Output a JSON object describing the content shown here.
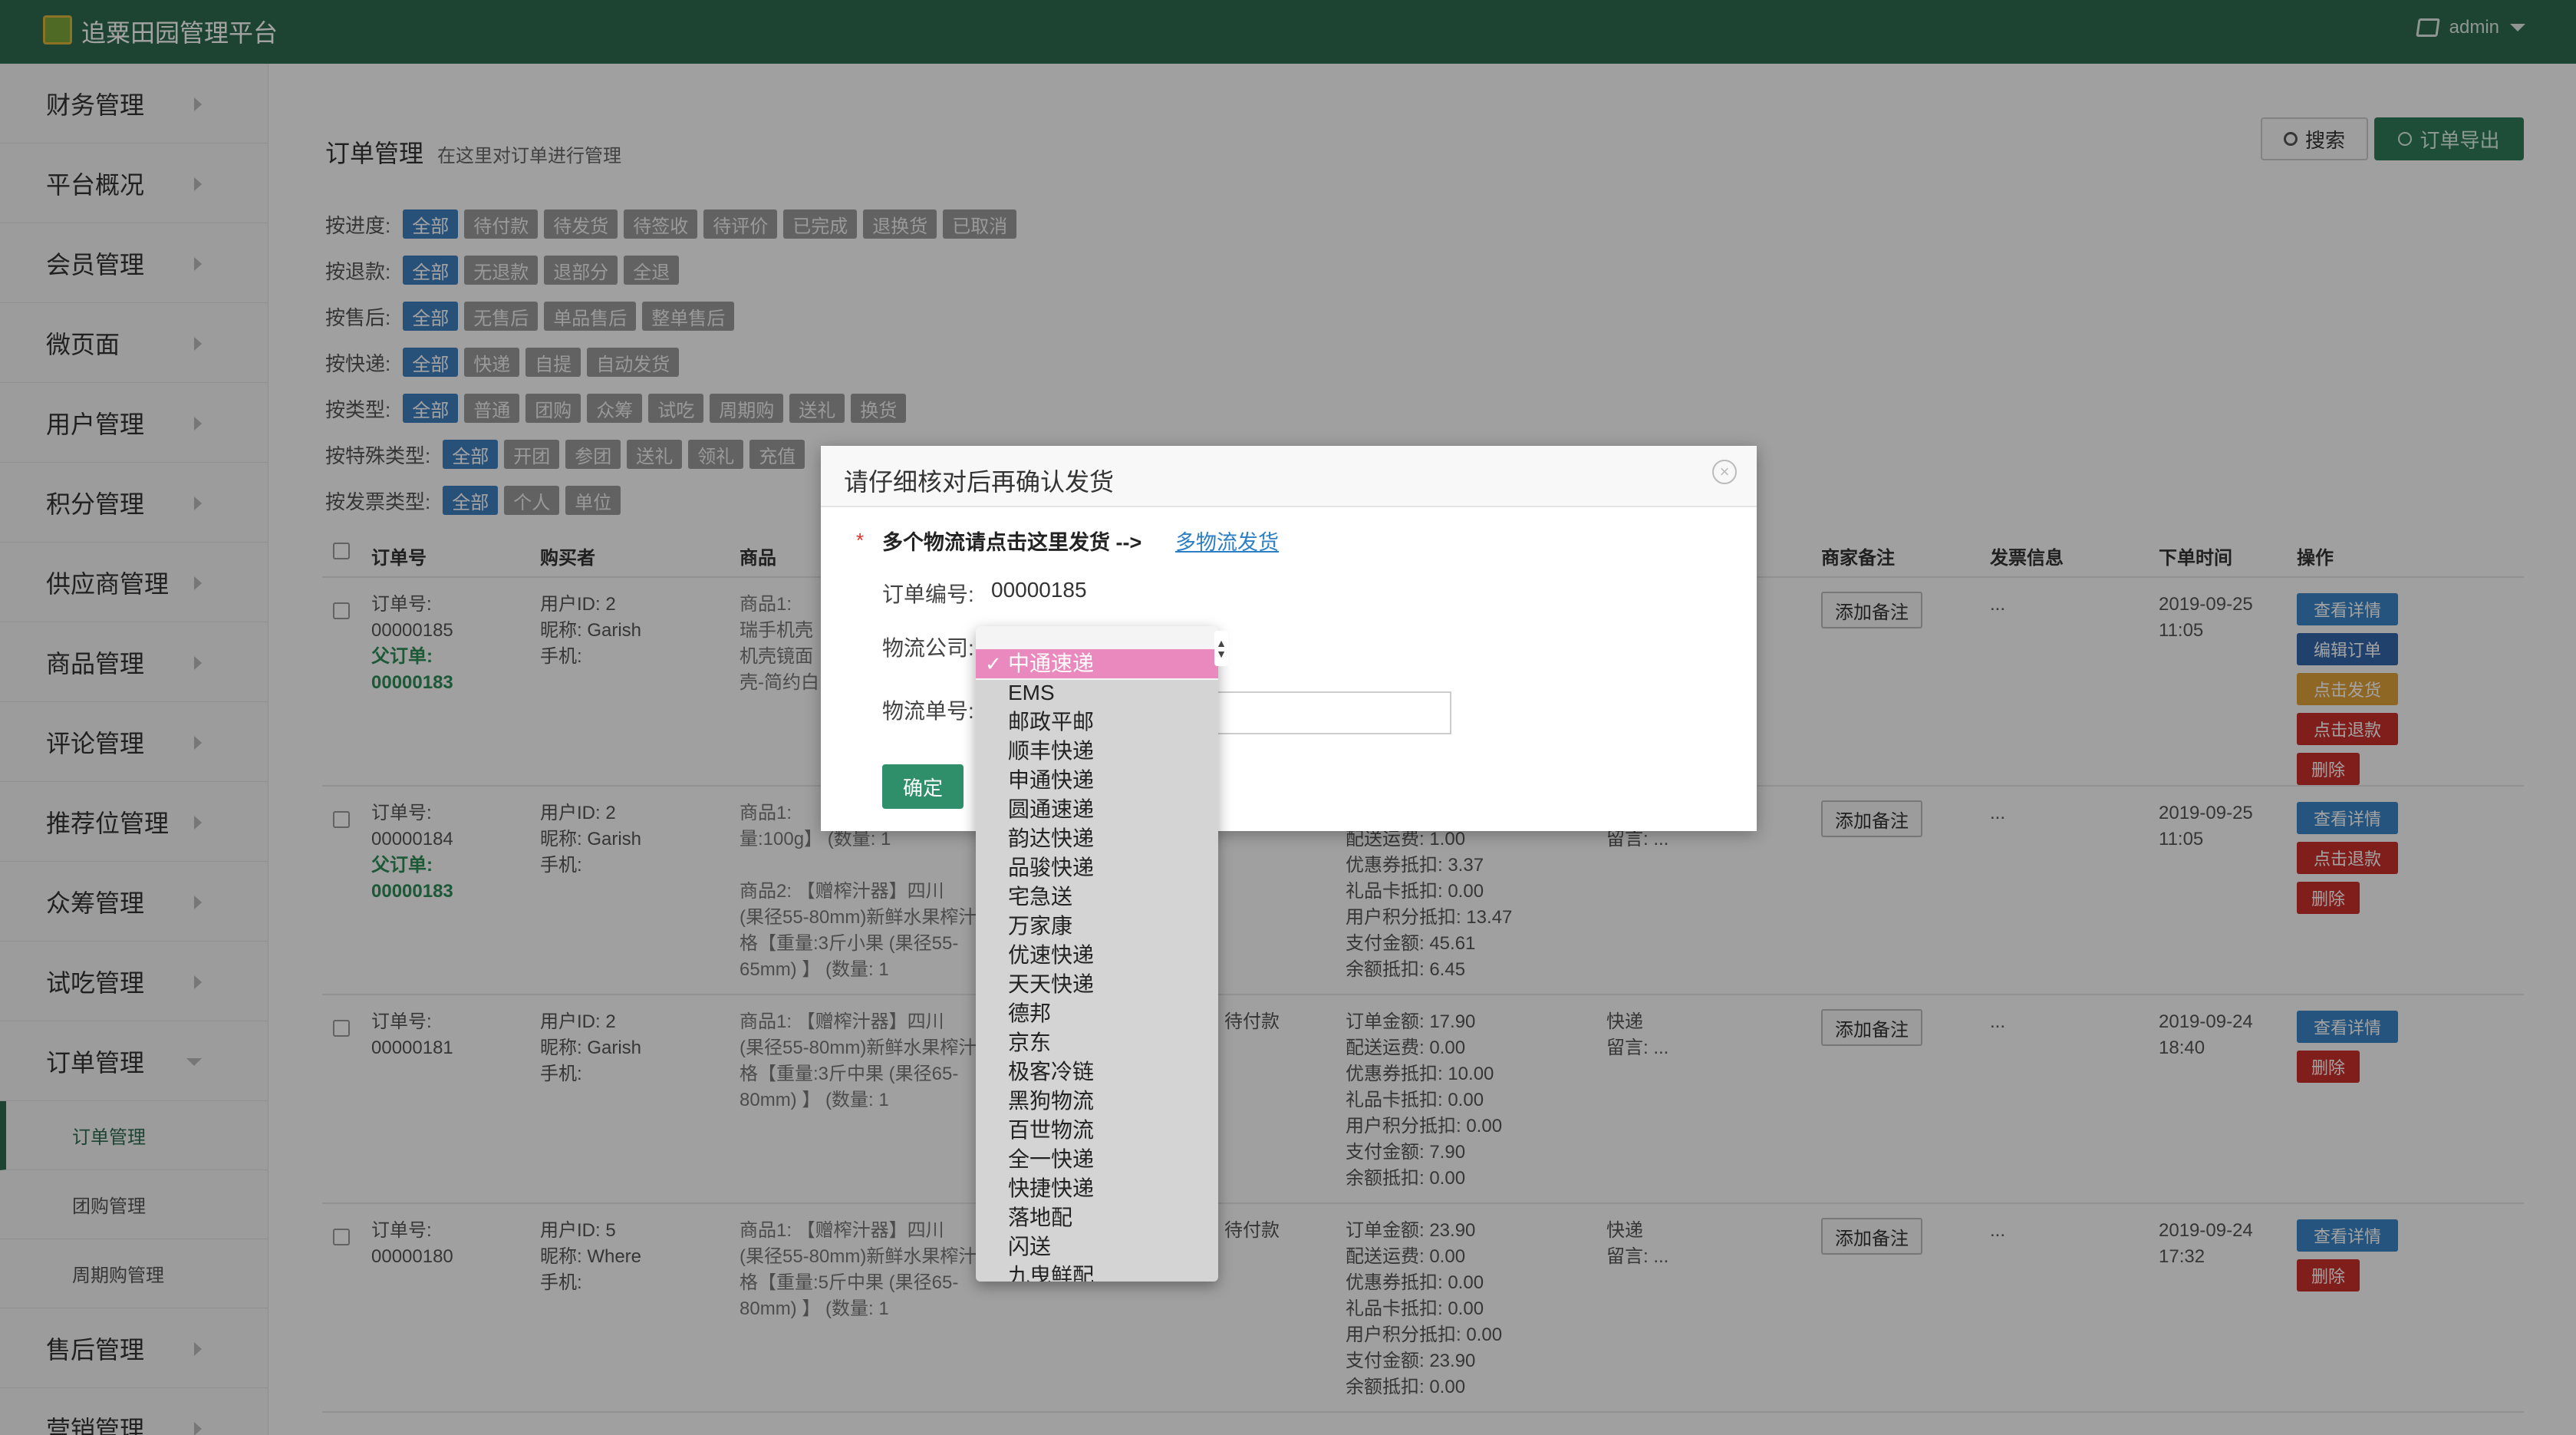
{
  "app": {
    "title": "追粟田园管理平台",
    "user": "admin"
  },
  "sidebar": {
    "items": [
      {
        "label": "财务管理"
      },
      {
        "label": "平台概况"
      },
      {
        "label": "会员管理"
      },
      {
        "label": "微页面"
      },
      {
        "label": "用户管理"
      },
      {
        "label": "积分管理"
      },
      {
        "label": "供应商管理"
      },
      {
        "label": "商品管理"
      },
      {
        "label": "评论管理"
      },
      {
        "label": "推荐位管理"
      },
      {
        "label": "众筹管理"
      },
      {
        "label": "试吃管理"
      },
      {
        "label": "订单管理"
      }
    ],
    "subitems": [
      {
        "label": "订单管理"
      },
      {
        "label": "团购管理"
      },
      {
        "label": "周期购管理"
      }
    ],
    "tail": [
      {
        "label": "售后管理"
      },
      {
        "label": "营销管理"
      }
    ]
  },
  "page": {
    "title": "订单管理",
    "subtitle": "在这里对订单进行管理"
  },
  "toolbar": {
    "search": "搜索",
    "export": "订单导出"
  },
  "filters": [
    {
      "label": "按进度:",
      "chips": [
        "全部",
        "待付款",
        "待发货",
        "待签收",
        "待评价",
        "已完成",
        "退换货",
        "已取消"
      ]
    },
    {
      "label": "按退款:",
      "chips": [
        "全部",
        "无退款",
        "退部分",
        "全退"
      ]
    },
    {
      "label": "按售后:",
      "chips": [
        "全部",
        "无售后",
        "单品售后",
        "整单售后"
      ]
    },
    {
      "label": "按快递:",
      "chips": [
        "全部",
        "快递",
        "自提",
        "自动发货"
      ]
    },
    {
      "label": "按类型:",
      "chips": [
        "全部",
        "普通",
        "团购",
        "众筹",
        "试吃",
        "周期购",
        "送礼",
        "换货"
      ]
    },
    {
      "label": "按特殊类型:",
      "chips": [
        "全部",
        "开团",
        "参团",
        "送礼",
        "领礼",
        "充值"
      ]
    },
    {
      "label": "按发票类型:",
      "chips": [
        "全部",
        "个人",
        "单位"
      ]
    }
  ],
  "table": {
    "headers": [
      "订单号",
      "购买者",
      "商品",
      "商家备注",
      "发票信息",
      "下单时间",
      "操作"
    ],
    "rows": [
      {
        "order_label": "订单号:",
        "order_no": "00000185",
        "parent_label": "父订单:",
        "parent_no": "00000183",
        "buyer": [
          "用户ID:  2",
          "昵称:  Garish",
          "手机:"
        ],
        "goods": [
          "商品1:",
          "瑞手机壳",
          "机壳镜面",
          "壳-简约白"
        ],
        "status": "",
        "amounts": [],
        "ship": [],
        "note_btn": "添加备注",
        "invoice": "...",
        "time": [
          "2019-09-25",
          "11:05"
        ],
        "actions": [
          {
            "label": "查看详情",
            "color": "blue"
          },
          {
            "label": "编辑订单",
            "color": "navy"
          },
          {
            "label": "点击发货",
            "color": "orange"
          },
          {
            "label": "点击退款",
            "color": "red"
          },
          {
            "label": "删除",
            "color": "red"
          }
        ]
      },
      {
        "order_label": "订单号:",
        "order_no": "00000184",
        "parent_label": "父订单:",
        "parent_no": "00000183",
        "buyer": [
          "用户ID:  2",
          "昵称:  Garish",
          "手机:"
        ],
        "goods": [
          "商品1:",
          "量:100g】  (数量:  1",
          "",
          "商品2:  【赠榨汁器】四川",
          "(果径55-80mm)新鲜水果榨汁",
          "格【重量:3斤小果 (果径55-",
          "65mm) 】  (数量:  1"
        ],
        "status": "",
        "amounts": [
          "配送运费:  1.00",
          "优惠券抵扣:  3.37",
          "礼品卡抵扣:  0.00",
          "用户积分抵扣:  13.47",
          "支付金额:  45.61",
          "余额抵扣:  6.45"
        ],
        "ship": [
          "快递",
          "留言:  ..."
        ],
        "note_btn": "添加备注",
        "invoice": "...",
        "time": [
          "2019-09-25",
          "11:05"
        ],
        "actions": [
          {
            "label": "查看详情",
            "color": "blue"
          },
          {
            "label": "点击退款",
            "color": "red"
          },
          {
            "label": "删除",
            "color": "red"
          }
        ]
      },
      {
        "order_label": "订单号:",
        "order_no": "00000181",
        "parent_label": "",
        "parent_no": "",
        "buyer": [
          "用户ID:  2",
          "昵称:  Garish",
          "手机:"
        ],
        "goods": [
          "商品1:   【赠榨汁器】四川",
          "(果径55-80mm)新鲜水果榨汁",
          "格【重量:3斤中果 (果径65-",
          "80mm) 】  (数量:  1"
        ],
        "status": "待付款",
        "amounts": [
          "订单金额:  17.90",
          "配送运费:  0.00",
          "优惠券抵扣:  10.00",
          "礼品卡抵扣:  0.00",
          "用户积分抵扣:  0.00",
          "支付金额:  7.90",
          "余额抵扣:  0.00"
        ],
        "ship": [
          "快递",
          "留言:  ..."
        ],
        "note_btn": "添加备注",
        "invoice": "...",
        "time": [
          "2019-09-24",
          "18:40"
        ],
        "actions": [
          {
            "label": "查看详情",
            "color": "blue"
          },
          {
            "label": "删除",
            "color": "red"
          }
        ]
      },
      {
        "order_label": "订单号:",
        "order_no": "00000180",
        "parent_label": "",
        "parent_no": "",
        "buyer": [
          "用户ID:  5",
          "昵称:  Where",
          "手机:"
        ],
        "goods": [
          "商品1:   【赠榨汁器】四川",
          "(果径55-80mm)新鲜水果榨汁",
          "格【重量:5斤中果 (果径65-",
          "80mm) 】  (数量:  1"
        ],
        "status": "待付款",
        "amounts": [
          "订单金额:  23.90",
          "配送运费:  0.00",
          "优惠券抵扣:  0.00",
          "礼品卡抵扣:  0.00",
          "用户积分抵扣:  0.00",
          "支付金额:  23.90",
          "余额抵扣:  0.00"
        ],
        "ship": [
          "快递",
          "留言:  ..."
        ],
        "note_btn": "添加备注",
        "invoice": "...",
        "time": [
          "2019-09-24",
          "17:32"
        ],
        "actions": [
          {
            "label": "查看详情",
            "color": "blue"
          },
          {
            "label": "删除",
            "color": "red"
          }
        ]
      }
    ]
  },
  "modal": {
    "title": "请仔细核对后再确认发货",
    "required_mark": "*",
    "multi_text": "多个物流请点击这里发货 -->",
    "multi_link": "多物流发货",
    "order_label": "订单编号:",
    "order_value": "00000185",
    "company_label": "物流公司:",
    "waybill_label": "物流单号:",
    "confirm": "确定"
  },
  "logistics": {
    "selected": "中通速递",
    "options": [
      "中通速递",
      "EMS",
      "邮政平邮",
      "顺丰快递",
      "申通快递",
      "圆通速递",
      "韵达快递",
      "品骏快递",
      "宅急送",
      "万家康",
      "优速快递",
      "天天快递",
      "德邦",
      "京东",
      "极客冷链",
      "黑狗物流",
      "百世物流",
      "全一快递",
      "快捷快递",
      "落地配",
      "闪送",
      "九曳鲜配"
    ]
  }
}
